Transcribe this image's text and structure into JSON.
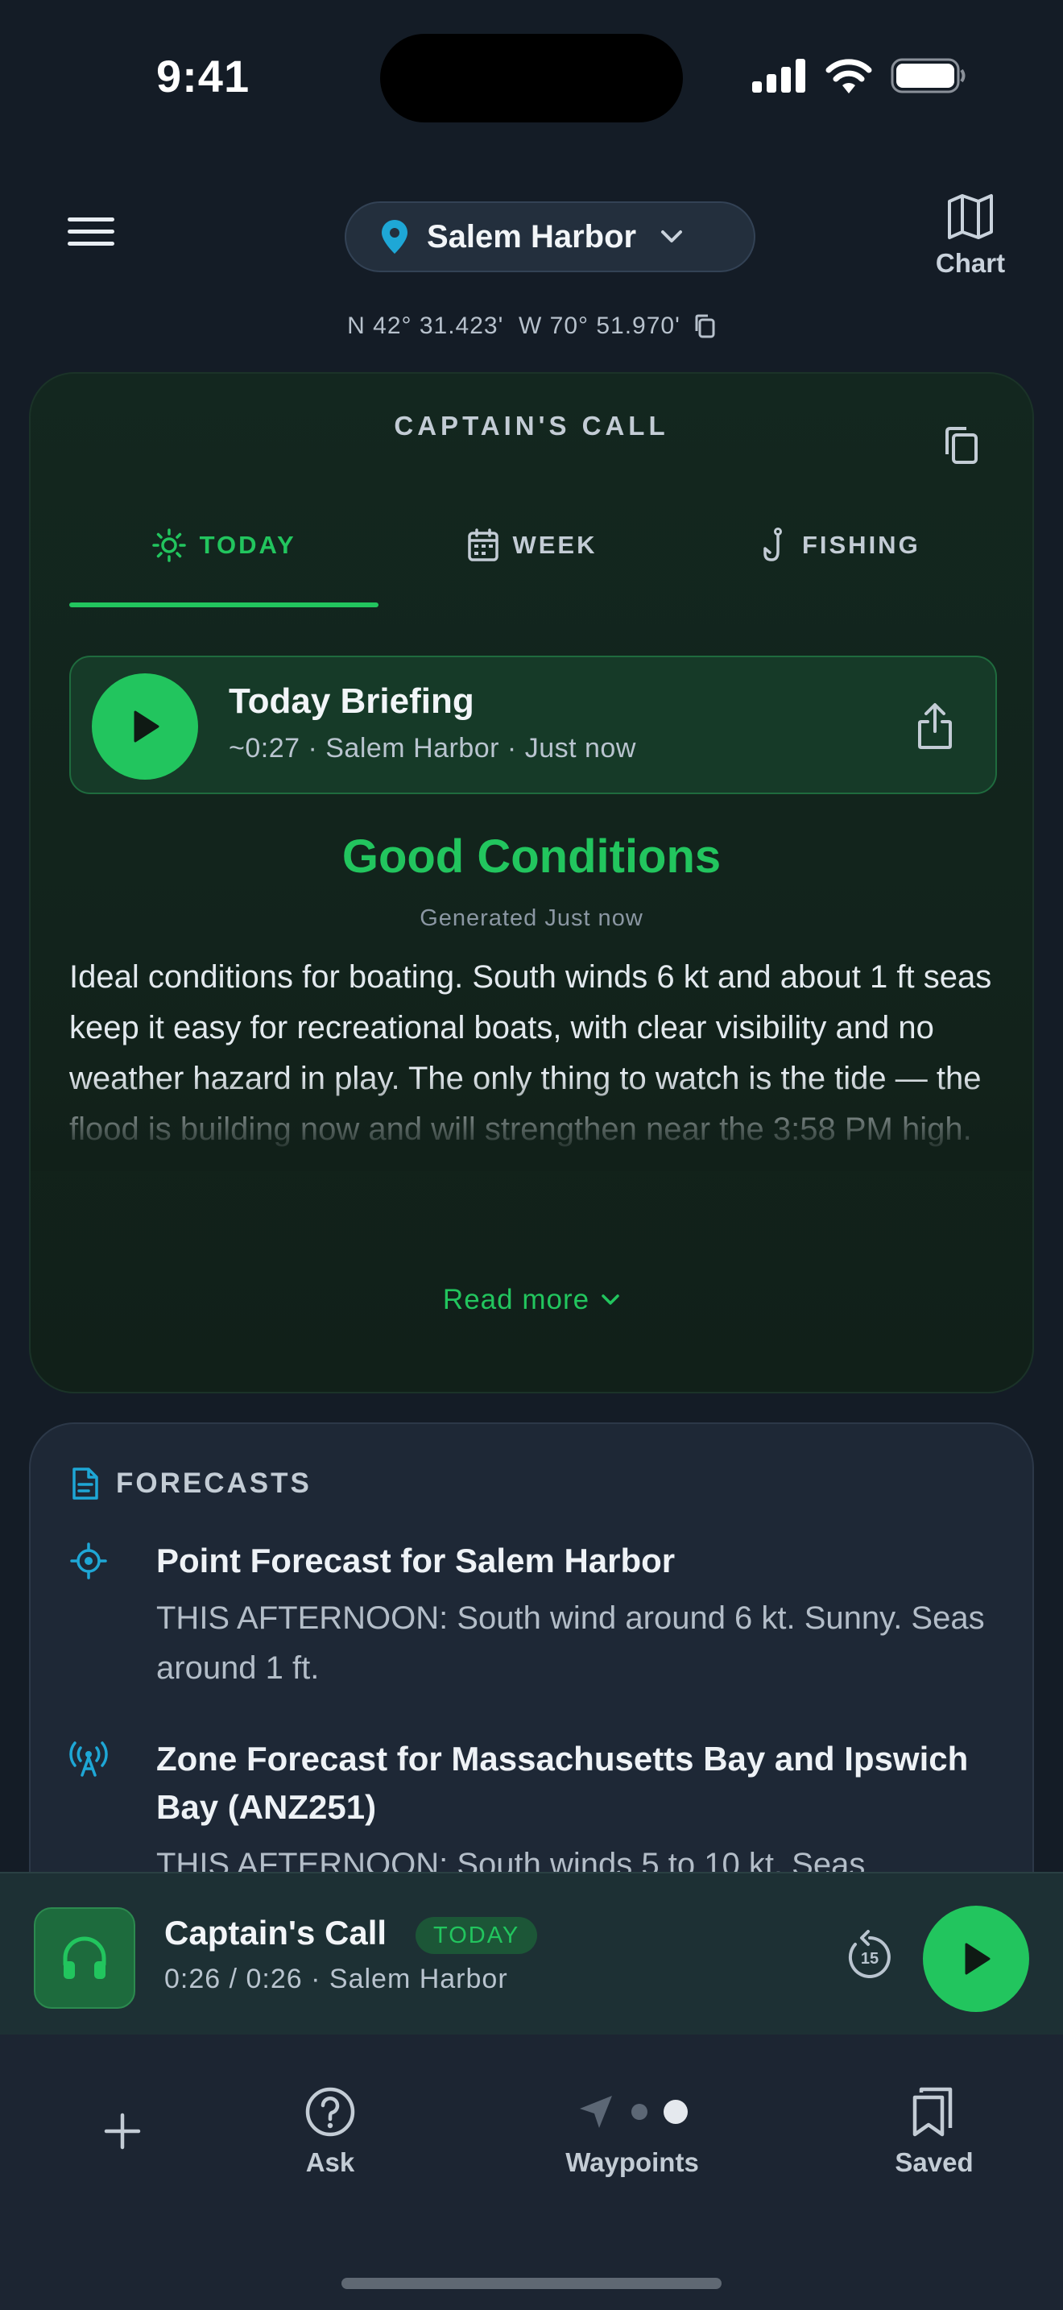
{
  "status": {
    "time": "9:41"
  },
  "header": {
    "location": "Salem Harbor",
    "chart_label": "Chart",
    "coords": "N 42° 31.423'  W 70° 51.970'"
  },
  "captains_call": {
    "title": "CAPTAIN'S CALL",
    "tabs": [
      {
        "label": "TODAY",
        "icon": "sun-icon",
        "active": true
      },
      {
        "label": "WEEK",
        "icon": "calendar-icon",
        "active": false
      },
      {
        "label": "FISHING",
        "icon": "fishhook-icon",
        "active": false
      }
    ],
    "briefing": {
      "title": "Today Briefing",
      "subtitle": "~0:27 · Salem Harbor · Just now"
    },
    "condition": "Good Conditions",
    "generated": "Generated Just now",
    "body": "Ideal conditions for boating. South winds 6 kt and about 1 ft seas keep it easy for recreational boats, with clear visibility and no weather hazard in play. The only thing to watch is the tide — the flood is building now and will strengthen near the 3:58 PM high.",
    "read_more": "Read more"
  },
  "forecasts": {
    "title": "FORECASTS",
    "items": [
      {
        "title": "Point Forecast for Salem Harbor",
        "text": "THIS AFTERNOON: South wind around 6 kt. Sunny. Seas around 1 ft.",
        "icon": "target-icon"
      },
      {
        "title": "Zone Forecast for Massachusetts Bay and Ipswich Bay (ANZ251)",
        "text": "THIS AFTERNOON: South winds 5 to 10 kt. Seas",
        "icon": "radio-tower-icon"
      }
    ]
  },
  "now_playing": {
    "title": "Captain's Call",
    "badge": "TODAY",
    "subtitle": "0:26 / 0:26 · Salem Harbor",
    "skip_seconds": "15"
  },
  "nav": {
    "items": [
      {
        "label": "Ask"
      },
      {
        "label": "Waypoints"
      },
      {
        "label": "Saved"
      }
    ]
  },
  "colors": {
    "accent": "#22c55e",
    "background": "#141c26",
    "card_green": "#13271f",
    "card_dark": "#1e2836"
  }
}
